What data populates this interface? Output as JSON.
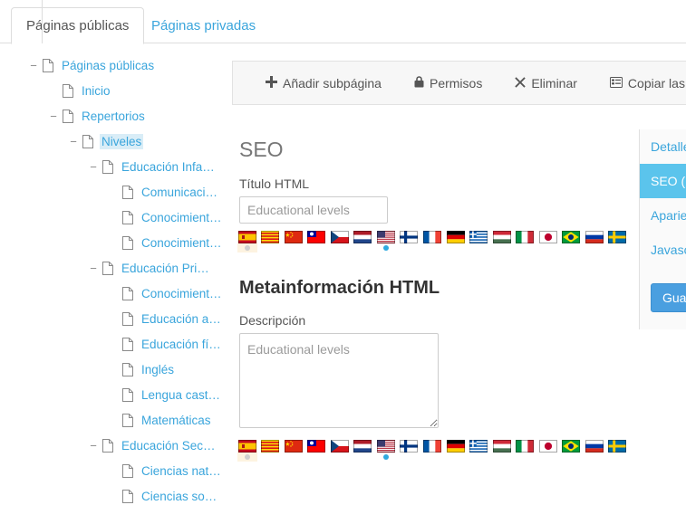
{
  "tabs": [
    {
      "label": "Páginas públicas",
      "active": true
    },
    {
      "label": "Páginas privadas",
      "active": false
    }
  ],
  "tree": {
    "nodes": [
      {
        "label": "Páginas públicas",
        "depth": 0,
        "toggle": "−",
        "selected": false
      },
      {
        "label": "Inicio",
        "depth": 1,
        "toggle": "",
        "selected": false
      },
      {
        "label": "Repertorios",
        "depth": 1,
        "toggle": "−",
        "selected": false
      },
      {
        "label": "Niveles",
        "depth": 2,
        "toggle": "−",
        "selected": true
      },
      {
        "label": "Educación Infa…",
        "depth": 3,
        "toggle": "−",
        "selected": false
      },
      {
        "label": "Comunicació…",
        "depth": 4,
        "toggle": "",
        "selected": false
      },
      {
        "label": "Conocimient…",
        "depth": 4,
        "toggle": "",
        "selected": false
      },
      {
        "label": "Conocimient…",
        "depth": 4,
        "toggle": "",
        "selected": false
      },
      {
        "label": "Educación Pri…",
        "depth": 3,
        "toggle": "−",
        "selected": false
      },
      {
        "label": "Conocimient…",
        "depth": 4,
        "toggle": "",
        "selected": false
      },
      {
        "label": "Educación a…",
        "depth": 4,
        "toggle": "",
        "selected": false
      },
      {
        "label": "Educación fí…",
        "depth": 4,
        "toggle": "",
        "selected": false
      },
      {
        "label": "Inglés",
        "depth": 4,
        "toggle": "",
        "selected": false
      },
      {
        "label": "Lengua cast…",
        "depth": 4,
        "toggle": "",
        "selected": false
      },
      {
        "label": "Matemáticas",
        "depth": 4,
        "toggle": "",
        "selected": false
      },
      {
        "label": "Educación Sec…",
        "depth": 3,
        "toggle": "−",
        "selected": false
      },
      {
        "label": "Ciencias nat…",
        "depth": 4,
        "toggle": "",
        "selected": false
      },
      {
        "label": "Ciencias soc…",
        "depth": 4,
        "toggle": "",
        "selected": false
      }
    ]
  },
  "toolbar": {
    "buttons": [
      {
        "label": "Añadir subpágina",
        "icon": "plus-icon",
        "glyph": "➕"
      },
      {
        "label": "Permisos",
        "icon": "lock-icon",
        "glyph": "🔒"
      },
      {
        "label": "Eliminar",
        "icon": "remove-icon",
        "glyph": "✖"
      },
      {
        "label": "Copiar las aplic",
        "icon": "list-alt-icon",
        "glyph": "▤"
      }
    ]
  },
  "seo": {
    "heading": "SEO",
    "title_label": "Título HTML",
    "title_value": "",
    "title_placeholder": "Educational levels"
  },
  "meta": {
    "heading": "Metainformación HTML",
    "description_label": "Descripción",
    "description_value": "",
    "description_placeholder": "Educational levels"
  },
  "locales": [
    {
      "name": "es",
      "country": "Spain",
      "state": "active-grey"
    },
    {
      "name": "ca",
      "country": "Catalonia",
      "state": "none"
    },
    {
      "name": "zh",
      "country": "China",
      "state": "none"
    },
    {
      "name": "zh-TW",
      "country": "Taiwan",
      "state": "none"
    },
    {
      "name": "cs",
      "country": "Czechia",
      "state": "none"
    },
    {
      "name": "nl",
      "country": "Netherlands",
      "state": "none"
    },
    {
      "name": "en",
      "country": "United States",
      "state": "blue"
    },
    {
      "name": "fi",
      "country": "Finland",
      "state": "none"
    },
    {
      "name": "fr",
      "country": "France",
      "state": "none"
    },
    {
      "name": "de",
      "country": "Germany",
      "state": "none"
    },
    {
      "name": "el",
      "country": "Greece",
      "state": "none"
    },
    {
      "name": "hu",
      "country": "Hungary",
      "state": "none"
    },
    {
      "name": "it",
      "country": "Italy",
      "state": "none"
    },
    {
      "name": "ja",
      "country": "Japan",
      "state": "none"
    },
    {
      "name": "pt-BR",
      "country": "Brazil",
      "state": "none"
    },
    {
      "name": "ru",
      "country": "Russia",
      "state": "none"
    },
    {
      "name": "sv",
      "country": "Sweden",
      "state": "none"
    }
  ],
  "sidepanel": {
    "items": [
      {
        "label": "Detalle",
        "active": false
      },
      {
        "label": "SEO (",
        "active": true
      },
      {
        "label": "Aparie",
        "active": false
      },
      {
        "label": "Javasc",
        "active": false
      }
    ],
    "save_label": "Gua"
  },
  "colors": {
    "link": "#3aa5dc",
    "active_panel": "#5bc4ec",
    "save_button": "#4a9fe0",
    "selection": "#d9edf7"
  }
}
